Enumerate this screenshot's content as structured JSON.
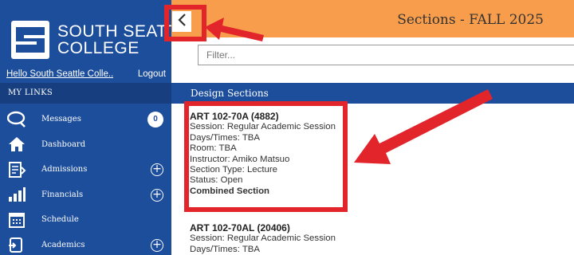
{
  "app": {
    "logo_line1": "SOUTH SEATTLE",
    "logo_line2": "COLLEGE"
  },
  "user": {
    "hello": "Hello South Seattle Colle..",
    "logout": "Logout"
  },
  "sidebar": {
    "section_label": "MY LINKS",
    "items": [
      {
        "label": "Messages",
        "icon": "messages-icon",
        "badge": "0"
      },
      {
        "label": "Dashboard",
        "icon": "home-icon"
      },
      {
        "label": "Admissions",
        "icon": "admissions-icon",
        "expand": "+"
      },
      {
        "label": "Financials",
        "icon": "financials-icon",
        "expand": "+"
      },
      {
        "label": "Schedule",
        "icon": "calendar-icon"
      },
      {
        "label": "Academics",
        "icon": "academics-icon",
        "expand": "+"
      }
    ]
  },
  "header": {
    "back": "<",
    "title": "Sections - FALL 2025"
  },
  "filter": {
    "placeholder": "Filter..."
  },
  "section_bar": {
    "title": "Design Sections"
  },
  "courses": [
    {
      "code": "ART 102-70A (4882)",
      "session": "Session: Regular Academic Session",
      "days": "Days/Times: TBA",
      "room": "Room: TBA",
      "instructor": "Instructor: Amiko Matsuo",
      "type": "Section Type: Lecture",
      "status": "Status: Open",
      "combined": "Combined Section"
    },
    {
      "code": "ART 102-70AL (20406)",
      "session": "Session: Regular Academic Session",
      "days": "Days/Times: TBA"
    }
  ],
  "colors": {
    "sidebar_blue": "#1d4e9c",
    "header_orange": "#f79d4c",
    "highlight_red": "#e2242b"
  }
}
